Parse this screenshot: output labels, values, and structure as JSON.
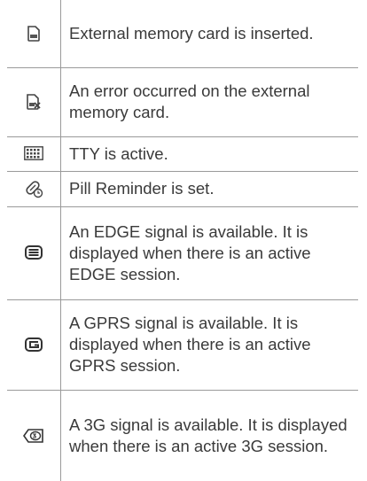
{
  "rows": [
    {
      "icon": "memory-card-icon",
      "text": "External memory card is inserted."
    },
    {
      "icon": "memory-card-error-icon",
      "text": "An error occurred on the external memory card."
    },
    {
      "icon": "tty-icon",
      "text": "TTY is active."
    },
    {
      "icon": "pill-reminder-icon",
      "text": "Pill Reminder is set."
    },
    {
      "icon": "edge-signal-icon",
      "text": "An EDGE signal is available. It is displayed when there is an active EDGE session."
    },
    {
      "icon": "gprs-signal-icon",
      "text": "A GPRS signal is available. It is displayed when there is an active GPRS session."
    },
    {
      "icon": "3g-signal-icon",
      "text": "A 3G signal is available. It is displayed when there is an active 3G session."
    }
  ]
}
